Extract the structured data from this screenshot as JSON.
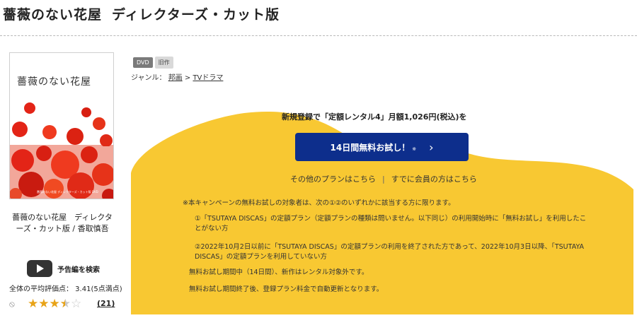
{
  "header": {
    "title": "薔薇のない花屋",
    "subtitle": "ディレクターズ・カット版"
  },
  "cover": {
    "title_text": "薔薇のない花屋",
    "caption": "薔薇のない花屋 ディレクターズ・カット版 DVD"
  },
  "item": {
    "title": "薔薇のない花屋　ディレクターズ・カット版 / 香取慎吾"
  },
  "trailer": {
    "label": "予告編を検索",
    "icon": "play-icon"
  },
  "rating": {
    "text": "全体の平均評価点： 3.41(5点満点)",
    "value": 3.41,
    "max": 5,
    "review_count": "(21)",
    "no_icon": "⦸"
  },
  "badges": [
    "DVD",
    "旧作"
  ],
  "genre": {
    "label": "ジャンル：",
    "path": [
      "邦画",
      "TVドラマ"
    ],
    "separator": ">"
  },
  "promo": {
    "text": "新規登録で「定額レンタル4」月額1,026円(税込)を",
    "button_label": "14日間無料お試し！",
    "button_mark": "※",
    "button_chevron": "›",
    "links": [
      "その他のプランはこちら",
      "すでに会員の方はこちら"
    ],
    "link_separator": "|"
  },
  "notes": {
    "intro": "※本キャンペーンの無料お試しの対象者は、次の①②のいずれかに該当する方に限ります。",
    "item1": "①「TSUTAYA DISCAS」の定額プラン（定額プランの種類は問いません。以下同じ）の利用開始時に「無料お試し」を利用したことがない方",
    "item2": "②2022年10月2日以前に「TSUTAYA DISCAS」の定額プランの利用を終了された方であって、2022年10月3日以降、「TSUTAYA DISCAS」の定額プランを利用していない方",
    "line3": "無料お試し期間中（14日間）、新作はレンタル対象外です。",
    "line4": "無料お試し期間終了後、登録プラン料金で自動更新となります。"
  },
  "colors": {
    "accent_yellow": "#f8c832",
    "button_blue": "#0d2e8c",
    "star": "#e8a317",
    "rose_red": "#e32417"
  }
}
